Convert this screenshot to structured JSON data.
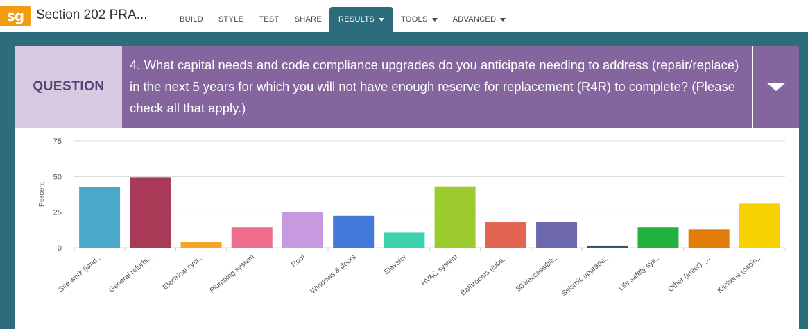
{
  "app": {
    "logo": "sg",
    "survey_title": "Section 202 PRA..."
  },
  "nav": [
    {
      "label": "BUILD",
      "active": false,
      "dropdown": false
    },
    {
      "label": "STYLE",
      "active": false,
      "dropdown": false
    },
    {
      "label": "TEST",
      "active": false,
      "dropdown": false
    },
    {
      "label": "SHARE",
      "active": false,
      "dropdown": false
    },
    {
      "label": "RESULTS",
      "active": true,
      "dropdown": true
    },
    {
      "label": "TOOLS",
      "active": false,
      "dropdown": true
    },
    {
      "label": "ADVANCED",
      "active": false,
      "dropdown": true
    }
  ],
  "question": {
    "label": "QUESTION",
    "text": "4. What capital needs and code compliance upgrades do you anticipate needing to address (repair/replace) in the next 5 years for which you will not have enough reserve for replacement (R4R) to complete? (Please check all that apply.)",
    "toggle_icon": "triangle-down-icon"
  },
  "colors": {
    "teal_frame": "#2d6d7b",
    "question_purple": "#84659e",
    "question_label_bg": "#d6c9e0",
    "logo_orange": "#f39c12"
  },
  "chart_data": {
    "type": "bar",
    "ylabel": "Percent",
    "ylim": [
      0,
      75
    ],
    "yticks": [
      "0",
      "25",
      "50",
      "75"
    ],
    "grid": true,
    "categories": [
      "Site work (land...",
      "General refurbi...",
      "Electrical syst...",
      "Plumbing system",
      "Roof",
      "Windows & doors",
      "Elevator",
      "HVAC system",
      "Bathrooms (tubs...",
      "504/accessibili...",
      "Seismic upgrade...",
      "Life safety sys...",
      "Other (enter) _...",
      "Kitchens (cabin..."
    ],
    "values": [
      42.5,
      49.5,
      4,
      14.5,
      25,
      22.5,
      11,
      43,
      18,
      18,
      1.5,
      14.5,
      13,
      31
    ],
    "colors": [
      "#4aa8c8",
      "#a83a58",
      "#f5a623",
      "#ee6d8e",
      "#c79ae0",
      "#4379d9",
      "#3dd1ae",
      "#9ccb2e",
      "#e46454",
      "#6d68ab",
      "#3d4f7a",
      "#22b03e",
      "#e27c0a",
      "#f8d200"
    ]
  }
}
